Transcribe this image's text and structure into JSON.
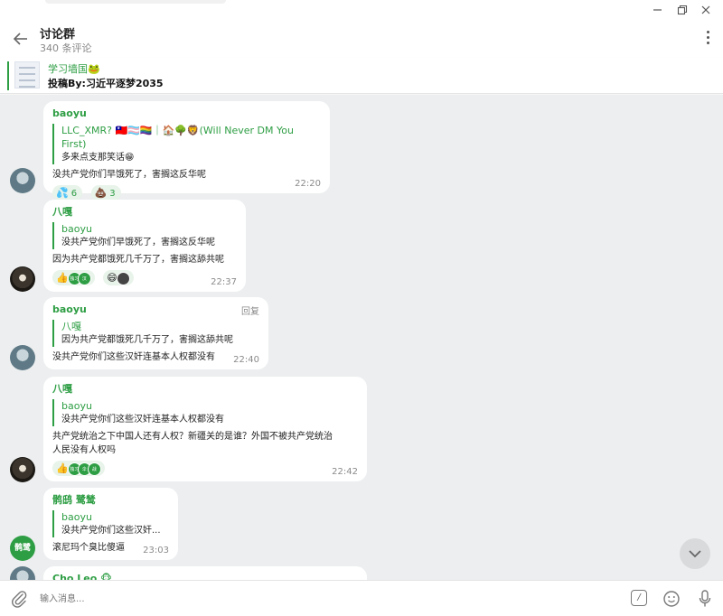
{
  "header": {
    "title": "讨论群",
    "subtitle": "340 条评论"
  },
  "pinned": {
    "title": "学习墙国🐸",
    "text": "投稿By:习近平逐梦2035"
  },
  "messages": [
    {
      "sender": "baoyu",
      "reply_name": "LLC_XMR? 🇹🇼🏳️‍⚧️🏳️‍🌈｜🏠🌳🦁(Will Never DM You First)",
      "reply_text": "多来点支那笑话😁",
      "body": "没共产党你们早饿死了，害搁这反华呢",
      "reactions": [
        {
          "emoji": "💦",
          "count": "6"
        },
        {
          "emoji": "💩",
          "count": "3"
        }
      ],
      "time": "22:20"
    },
    {
      "sender": "八嘎",
      "reply_name": "baoyu",
      "reply_text": "没共产党你们早饿死了，害搁这反华呢",
      "body": "因为共产党都饿死几千万了，害搁这舔共呢",
      "reaction_emoji_1": "👍",
      "reaction_emoji_2": "😄",
      "mini_1": "独习",
      "mini_2": "汉",
      "time": "22:37"
    },
    {
      "sender": "baoyu",
      "reply_link": "回复",
      "reply_name": "八嘎",
      "reply_text": "因为共产党都饿死几千万了，害搁这舔共呢",
      "body": "没共产党你们这些汉奸连基本人权都没有",
      "time": "22:40"
    },
    {
      "sender": "八嘎",
      "reply_name": "baoyu",
      "reply_text": "没共产党你们这些汉奸连基本人权都没有",
      "body_1": "共产党统治之下中国人还有人权？新疆关的是谁？外国不被共产党统治",
      "body_2": "人民没有人权吗",
      "reaction_emoji": "👍",
      "mini_1": "独习",
      "mini_2": "伞",
      "mini_3": "战",
      "time": "22:42"
    },
    {
      "sender": "鹘鸱 鹭鸶",
      "reply_name": "baoyu",
      "reply_text": "没共产党你们这些汉奸...",
      "body": "滚尼玛个臭比傻逼",
      "avatar_text": "鹘鹭",
      "time": "23:03"
    },
    {
      "sender": "Cho Leo 🐵"
    }
  ],
  "composer": {
    "placeholder": "输入消息..."
  },
  "icons": {
    "back": "arrow-left-icon",
    "more": "vertical-dots-icon",
    "attach": "paperclip-icon",
    "command": "slash-command-icon",
    "emoji": "smiley-icon",
    "mic": "microphone-icon",
    "scroll": "chevron-down-icon"
  },
  "colors": {
    "accent": "#2e9e44",
    "chat_background": "#eceeef",
    "bubble": "#ffffff"
  }
}
